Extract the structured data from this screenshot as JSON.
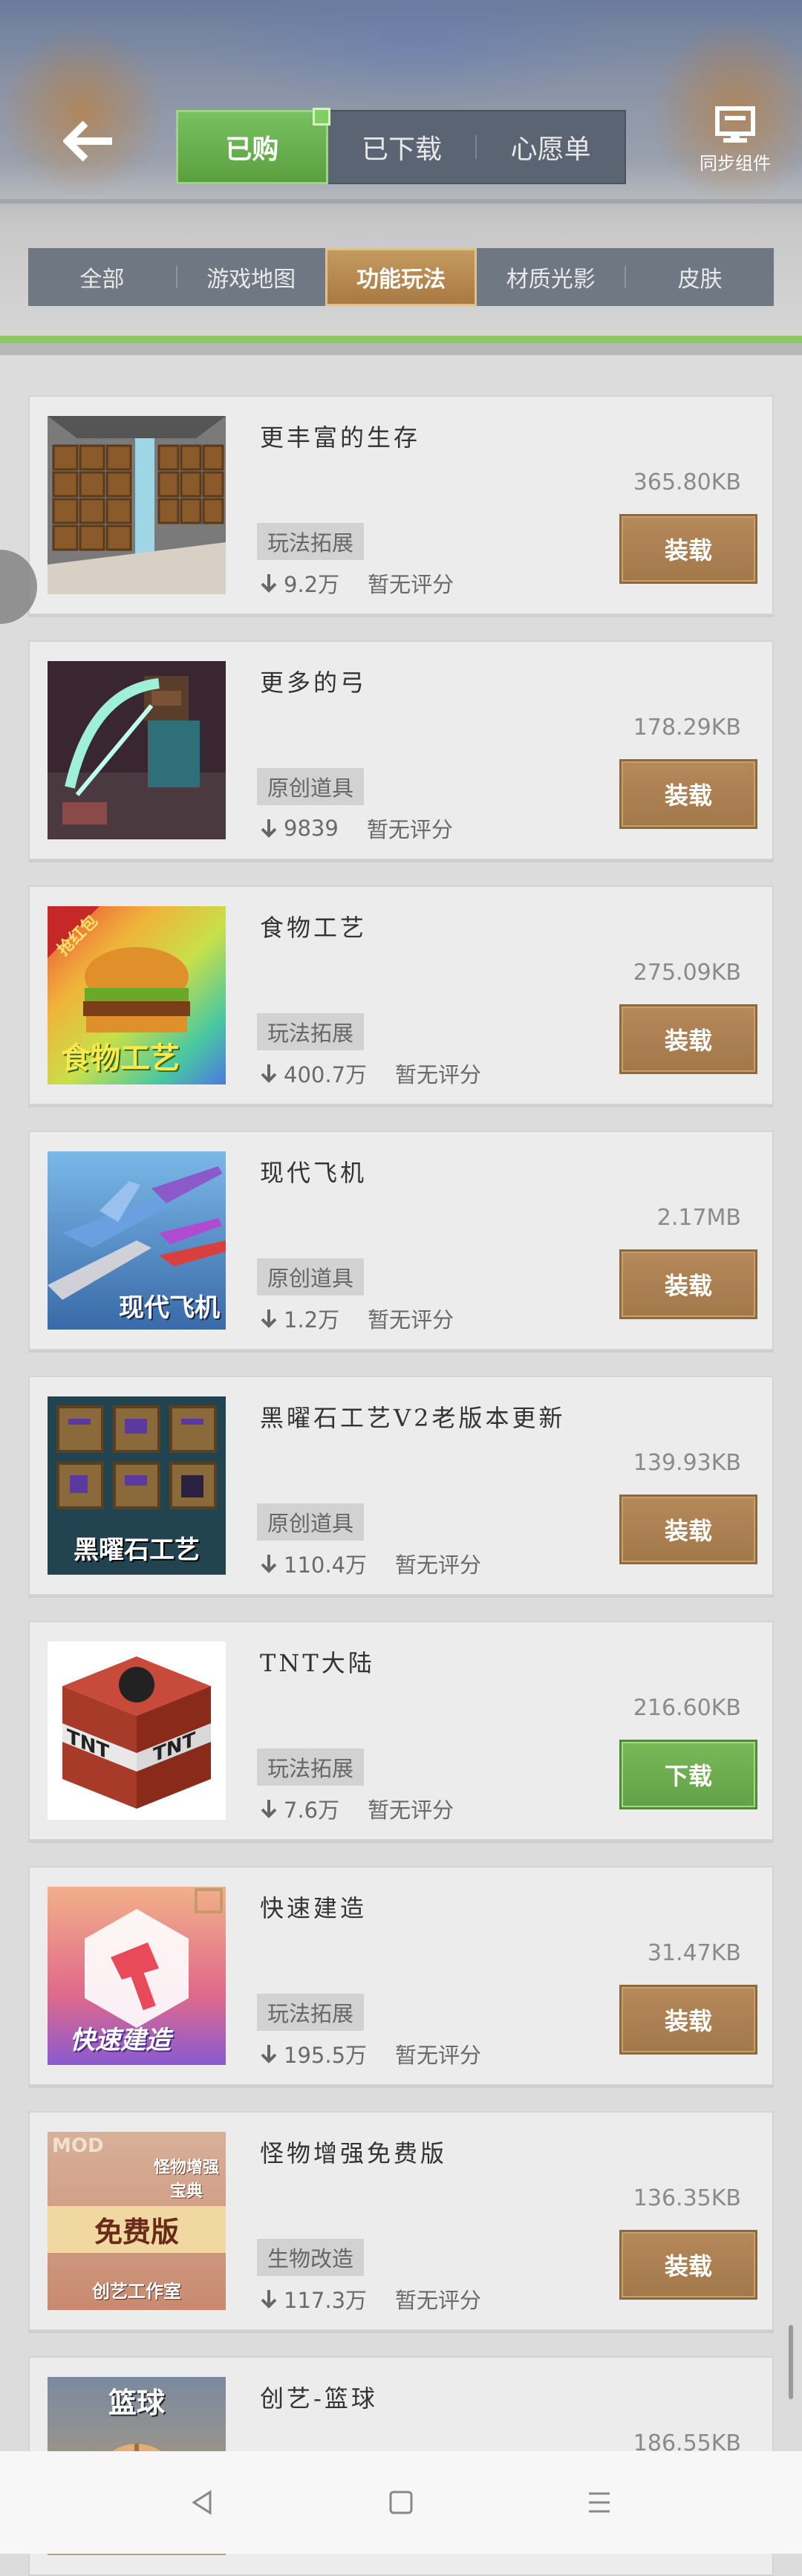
{
  "header": {
    "tabs": [
      {
        "label": "已购",
        "active": true
      },
      {
        "label": "已下载",
        "active": false
      },
      {
        "label": "心愿单",
        "active": false
      }
    ],
    "sync_label": "同步组件"
  },
  "categories": [
    {
      "label": "全部",
      "active": false
    },
    {
      "label": "游戏地图",
      "active": false
    },
    {
      "label": "功能玩法",
      "active": true
    },
    {
      "label": "材质光影",
      "active": false
    },
    {
      "label": "皮肤",
      "active": false
    }
  ],
  "items": [
    {
      "title": "更丰富的生存",
      "size": "365.80KB",
      "tag": "玩法拓展",
      "downloads": "9.2万",
      "rating": "暂无评分",
      "action": "装载",
      "thumb_text": ""
    },
    {
      "title": "更多的弓",
      "size": "178.29KB",
      "tag": "原创道具",
      "downloads": "9839",
      "rating": "暂无评分",
      "action": "装载",
      "thumb_text": ""
    },
    {
      "title": "食物工艺",
      "size": "275.09KB",
      "tag": "玩法拓展",
      "downloads": "400.7万",
      "rating": "暂无评分",
      "action": "装载",
      "thumb_text": "食物工艺",
      "thumb_badge": "抢红包"
    },
    {
      "title": "现代飞机",
      "size": "2.17MB",
      "tag": "原创道具",
      "downloads": "1.2万",
      "rating": "暂无评分",
      "action": "装载",
      "thumb_text": "现代飞机"
    },
    {
      "title": "黑曜石工艺V2老版本更新",
      "size": "139.93KB",
      "tag": "原创道具",
      "downloads": "110.4万",
      "rating": "暂无评分",
      "action": "装载",
      "thumb_text": "黑曜石工艺"
    },
    {
      "title": "TNT大陆",
      "size": "216.60KB",
      "tag": "玩法拓展",
      "downloads": "7.6万",
      "rating": "暂无评分",
      "action": "下载",
      "thumb_text": "TNT"
    },
    {
      "title": "快速建造",
      "size": "31.47KB",
      "tag": "玩法拓展",
      "downloads": "195.5万",
      "rating": "暂无评分",
      "action": "装载",
      "thumb_text": "快速建造"
    },
    {
      "title": "怪物增强免费版",
      "size": "136.35KB",
      "tag": "生物改造",
      "downloads": "117.3万",
      "rating": "暂无评分",
      "action": "装载",
      "thumb_text": "免费版",
      "thumb_top": "MOD",
      "thumb_sub": "怪物增强宝典",
      "thumb_footer": "创艺工作室"
    },
    {
      "title": "创艺-篮球",
      "size": "186.55KB",
      "tag": "",
      "downloads": "",
      "rating": "",
      "action": "",
      "thumb_text": "篮球"
    }
  ],
  "colors": {
    "load_button": "#a87d4e",
    "download_button": "#6aab4c",
    "active_tab": "#6cb452",
    "active_category": "#b88a52"
  }
}
